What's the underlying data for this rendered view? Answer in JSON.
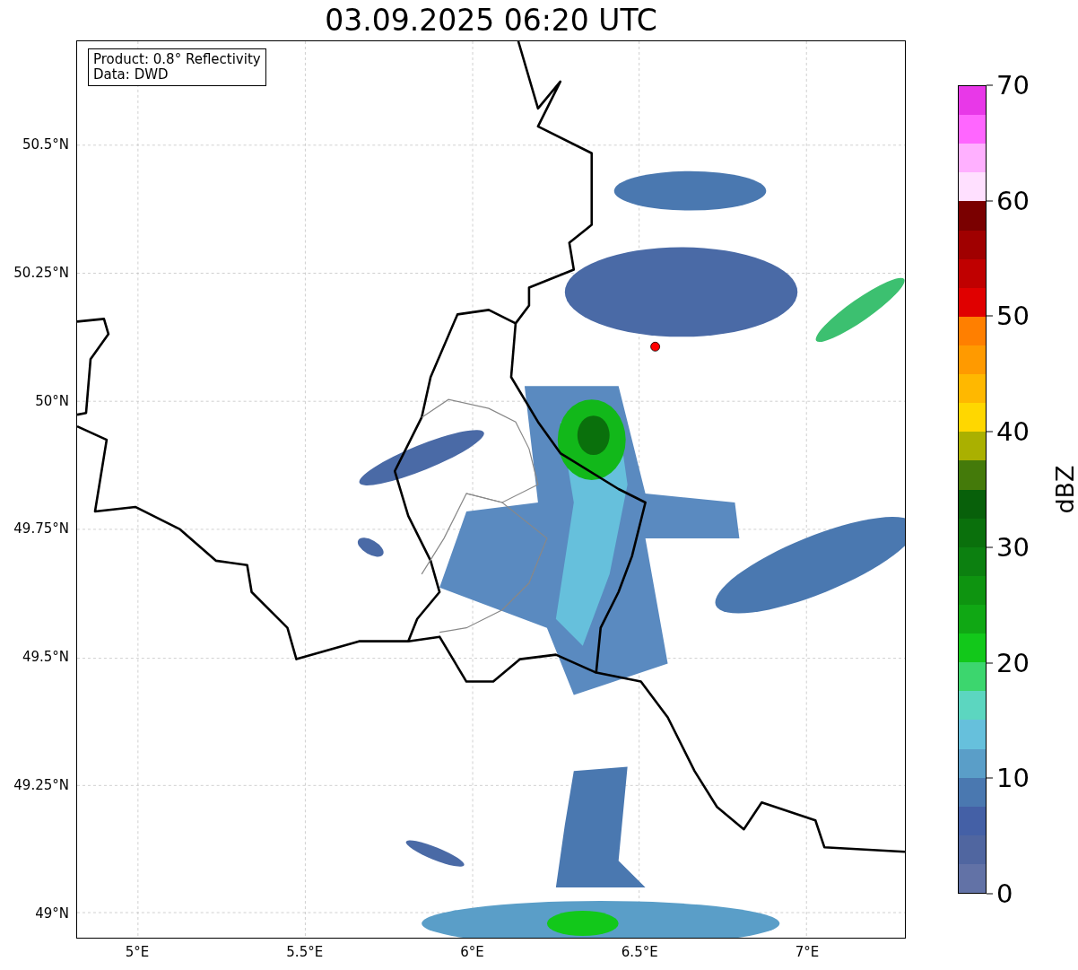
{
  "title": "03.09.2025 06:20 UTC",
  "info_box": [
    "Product: 0.8° Reflectivity",
    "Data: DWD"
  ],
  "map": {
    "x_ticks": [
      "5°E",
      "5.5°E",
      "6°E",
      "6.5°E",
      "7°E"
    ],
    "y_ticks": [
      "50.5°N",
      "50.25°N",
      "50°N",
      "49.75°N",
      "49.5°N",
      "49.25°N",
      "49°N"
    ]
  },
  "colorbar": {
    "label": "dBZ",
    "ticks": [
      "70",
      "60",
      "50",
      "40",
      "30",
      "20",
      "10",
      "0"
    ],
    "bands": [
      {
        "color": "#e838e8"
      },
      {
        "color": "#ff66ff"
      },
      {
        "color": "#ffb0ff"
      },
      {
        "color": "#ffe0ff"
      },
      {
        "color": "#7a0000"
      },
      {
        "color": "#a00000"
      },
      {
        "color": "#c00000"
      },
      {
        "color": "#e00000"
      },
      {
        "color": "#ff7f00"
      },
      {
        "color": "#ff9a00"
      },
      {
        "color": "#ffb800"
      },
      {
        "color": "#ffd700"
      },
      {
        "color": "#aab000"
      },
      {
        "color": "#447a0a"
      },
      {
        "color": "#08600a"
      },
      {
        "color": "#0a700c"
      },
      {
        "color": "#0c8010"
      },
      {
        "color": "#0e9410"
      },
      {
        "color": "#10a814"
      },
      {
        "color": "#12c81a"
      },
      {
        "color": "#3cd66e"
      },
      {
        "color": "#5cd6c0"
      },
      {
        "color": "#66c0dc"
      },
      {
        "color": "#5a9ec8"
      },
      {
        "color": "#4a78b0"
      },
      {
        "color": "#4460a6"
      },
      {
        "color": "#5066a0"
      },
      {
        "color": "#6272a6"
      }
    ]
  }
}
